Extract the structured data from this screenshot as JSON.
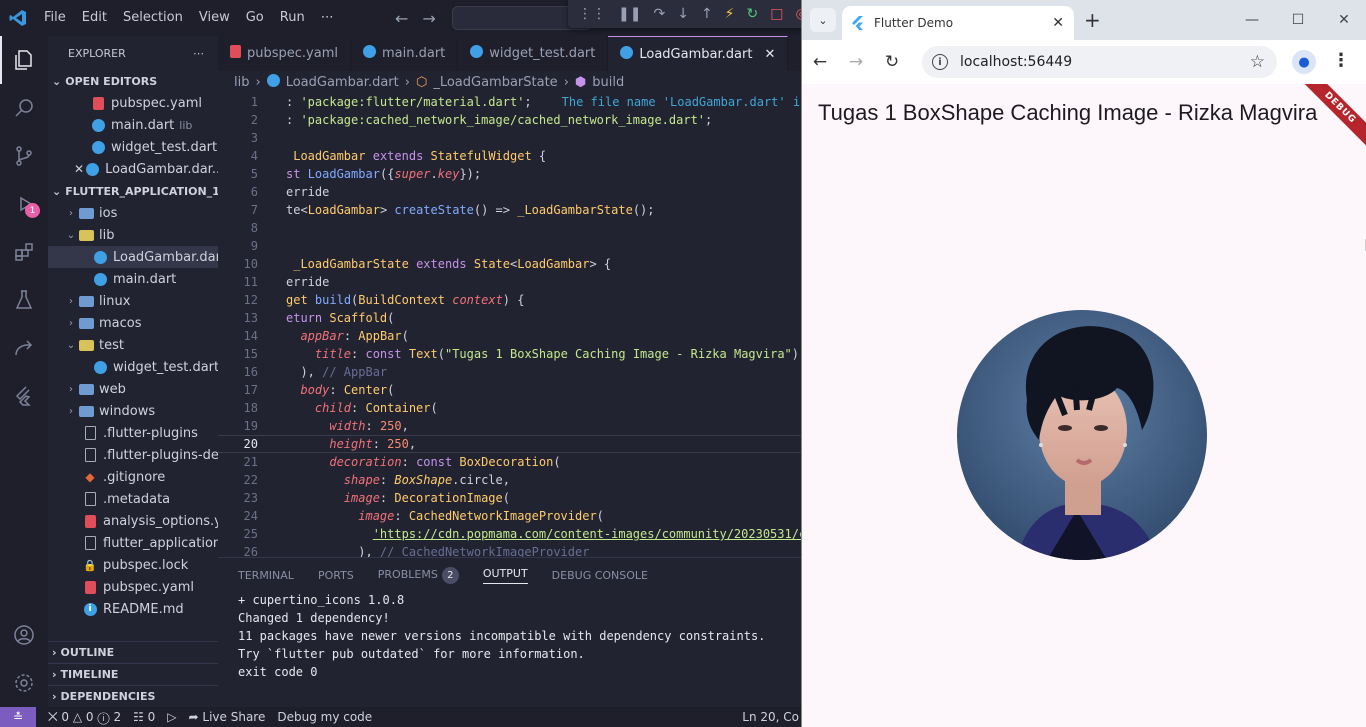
{
  "vscode": {
    "menu": [
      "File",
      "Edit",
      "Selection",
      "View",
      "Go",
      "Run",
      "⋯"
    ],
    "activity_badge": "1",
    "explorer": {
      "title": "EXPLORER",
      "more": "⋯",
      "open_editors_title": "OPEN EDITORS",
      "open_editors": [
        {
          "name": "pubspec.yaml",
          "note": "",
          "type": "yaml"
        },
        {
          "name": "main.dart",
          "note": "lib",
          "type": "dart"
        },
        {
          "name": "widget_test.dart...",
          "note": "",
          "type": "dart"
        },
        {
          "name": "LoadGambar.dar...",
          "note": "",
          "type": "dart"
        }
      ],
      "project_title": "FLUTTER_APPLICATION_1",
      "tree": [
        {
          "name": "ios",
          "kind": "folder"
        },
        {
          "name": "lib",
          "kind": "folder-open"
        },
        {
          "name": "LoadGambar.dart",
          "kind": "dart"
        },
        {
          "name": "main.dart",
          "kind": "dart"
        },
        {
          "name": "linux",
          "kind": "folder"
        },
        {
          "name": "macos",
          "kind": "folder"
        },
        {
          "name": "test",
          "kind": "folder-open"
        },
        {
          "name": "widget_test.dart",
          "kind": "dart"
        },
        {
          "name": "web",
          "kind": "folder"
        },
        {
          "name": "windows",
          "kind": "folder"
        },
        {
          "name": ".flutter-plugins",
          "kind": "file"
        },
        {
          "name": ".flutter-plugins-de...",
          "kind": "file"
        },
        {
          "name": ".gitignore",
          "kind": "git"
        },
        {
          "name": ".metadata",
          "kind": "file"
        },
        {
          "name": "analysis_options.y...",
          "kind": "yaml"
        },
        {
          "name": "flutter_application...",
          "kind": "file"
        },
        {
          "name": "pubspec.lock",
          "kind": "lock"
        },
        {
          "name": "pubspec.yaml",
          "kind": "yaml"
        },
        {
          "name": "README.md",
          "kind": "info"
        }
      ],
      "bottom_sections": [
        "OUTLINE",
        "TIMELINE",
        "DEPENDENCIES"
      ]
    },
    "tabs": [
      {
        "name": "pubspec.yaml",
        "type": "yaml"
      },
      {
        "name": "main.dart",
        "type": "dart"
      },
      {
        "name": "widget_test.dart",
        "type": "dart"
      },
      {
        "name": "LoadGambar.dart",
        "type": "dart"
      }
    ],
    "breadcrumb": [
      "lib",
      "LoadGambar.dart",
      "_LoadGambarState",
      "build"
    ],
    "current_line": 20,
    "hint_text": "The file name 'LoadGambar.dart' isn",
    "panel": {
      "tabs": [
        "TERMINAL",
        "PORTS",
        "PROBLEMS",
        "OUTPUT",
        "DEBUG CONSOLE"
      ],
      "problems_count": "2",
      "active": "OUTPUT",
      "output": [
        "+ cupertino_icons 1.0.8",
        "Changed 1 dependency!",
        "11 packages have newer versions incompatible with dependency constraints.",
        "Try `flutter pub outdated` for more information.",
        "exit code 0"
      ]
    },
    "status": {
      "errors": "0",
      "warnings": "0",
      "info": "2",
      "ports": "0",
      "live_share": "Live Share",
      "debug": "Debug my code",
      "position": "Ln 20, Co"
    }
  },
  "chrome": {
    "tab_title": "Flutter Demo",
    "url": "localhost:56449",
    "page": {
      "appbar_title": "Tugas 1 BoxShape Caching Image - Rizka Magvira",
      "debug_banner": "DEBUG"
    }
  }
}
